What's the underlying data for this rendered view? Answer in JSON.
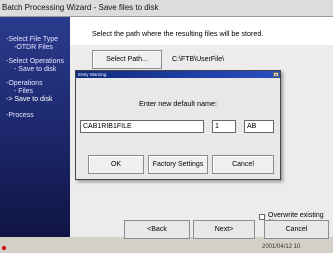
{
  "window": {
    "title": "Batch Processing Wizard - Save files to disk"
  },
  "sidebar": {
    "items": [
      {
        "label": "-Select File Type",
        "sub": "-OTDR Files"
      },
      {
        "label": "-Select Operations",
        "sub": "- Save to disk"
      },
      {
        "label": "-Operations",
        "sub": "- Files"
      },
      {
        "label": "",
        "sub": "-> Save to disk"
      },
      {
        "label": "-Process",
        "sub": ""
      }
    ]
  },
  "main": {
    "instruction": "Select the path where the resulting files will be stored.",
    "select_path_label": "Select Path...",
    "path_value": "C:\\FTB\\UserFile\\",
    "overwrite_label": "Overwrite existing files"
  },
  "dialog": {
    "title": "Entry Warning",
    "prompt": "Enter new default name:",
    "name_value": "CAB1RIB1FILE",
    "number_value": "1",
    "suffix_value": "AB",
    "ok_label": "OK",
    "factory_label": "Factory Settings",
    "cancel_label": "Cancel"
  },
  "footer": {
    "back_label": "<Back",
    "next_label": "Next>",
    "cancel_label": "Cancel",
    "status_date": "2001/04/12 10"
  },
  "colors": {
    "sidebar_top": "#2a3a8c",
    "sidebar_bottom": "#0f1240",
    "dialog_title": "#102a80"
  }
}
